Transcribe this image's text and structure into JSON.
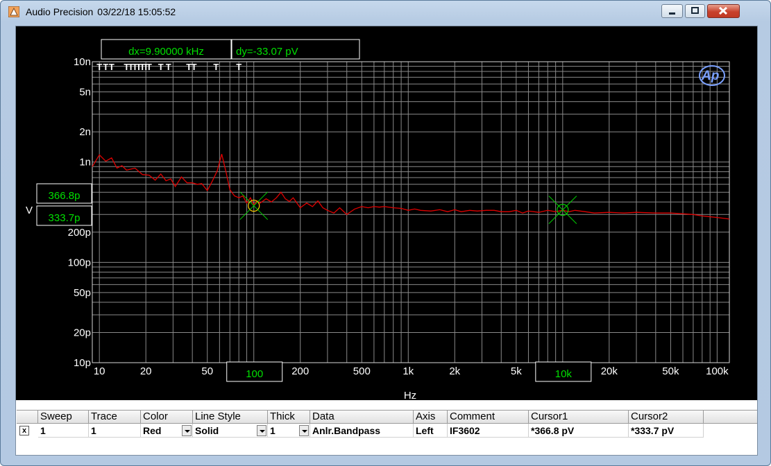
{
  "window": {
    "app_name": "Audio Precision",
    "timestamp": "03/22/18 15:05:52",
    "icon": "ap-app-icon",
    "buttons": [
      "minimize-icon",
      "maximize-icon",
      "close-icon"
    ]
  },
  "readouts": {
    "dx": "dx=9.90000 kHz",
    "dy": "dy=-33.07  pV",
    "cursor1_y": "366.8p",
    "cursor2_y": "333.7p",
    "cursor1_x": "100",
    "cursor2_x": "10k"
  },
  "colors": {
    "trace": "#e00000",
    "readout_text": "#00e000",
    "cursor1": "#ffd000",
    "cursor2": "#00d000",
    "grid": "#8a8a8a"
  },
  "chart_data": {
    "type": "line",
    "title": "",
    "xlabel": "Hz",
    "ylabel": "V",
    "x_scale": "log",
    "y_scale": "log",
    "xlim": [
      9,
      120000
    ],
    "ylim": [
      1e-11,
      1e-08
    ],
    "grid": true,
    "x_ticks": [
      {
        "v": 10,
        "label": "10"
      },
      {
        "v": 20,
        "label": "20"
      },
      {
        "v": 50,
        "label": "50"
      },
      {
        "v": 200,
        "label": "200"
      },
      {
        "v": 500,
        "label": "500"
      },
      {
        "v": 1000,
        "label": "1k"
      },
      {
        "v": 2000,
        "label": "2k"
      },
      {
        "v": 5000,
        "label": "5k"
      },
      {
        "v": 20000,
        "label": "20k"
      },
      {
        "v": 50000,
        "label": "50k"
      },
      {
        "v": 100000,
        "label": "100k"
      }
    ],
    "y_ticks": [
      {
        "v": 1e-08,
        "label": "10n"
      },
      {
        "v": 5e-09,
        "label": "5n"
      },
      {
        "v": 2e-09,
        "label": "2n"
      },
      {
        "v": 1e-09,
        "label": "1n"
      },
      {
        "v": 2e-10,
        "label": "200p"
      },
      {
        "v": 1e-10,
        "label": "100p"
      },
      {
        "v": 5e-11,
        "label": "50p"
      },
      {
        "v": 2e-11,
        "label": "20p"
      },
      {
        "v": 1e-11,
        "label": "10p"
      }
    ],
    "series": [
      {
        "color": "#e00000",
        "x": [
          9,
          10,
          11,
          12,
          13,
          14,
          15,
          17,
          19,
          21,
          23,
          25,
          27,
          29,
          31,
          34,
          37,
          40,
          43,
          46,
          50,
          54,
          58,
          62,
          66,
          70,
          75,
          80,
          85,
          90,
          95,
          100,
          105,
          110,
          120,
          130,
          140,
          150,
          160,
          170,
          180,
          190,
          200,
          220,
          240,
          260,
          280,
          300,
          330,
          360,
          400,
          450,
          500,
          550,
          600,
          650,
          700,
          800,
          900,
          1000,
          1100,
          1200,
          1400,
          1600,
          1800,
          2000,
          2200,
          2500,
          2800,
          3200,
          3600,
          4000,
          4500,
          5000,
          5500,
          6000,
          7000,
          8000,
          9000,
          10000,
          11000,
          12000,
          14000,
          16000,
          20000,
          25000,
          30000,
          40000,
          50000,
          60000,
          70000,
          80000,
          100000,
          120000
        ],
        "y": [
          9e-10,
          1.18e-09,
          1.02e-09,
          1.1e-09,
          8.7e-10,
          9.2e-10,
          8.3e-10,
          8.7e-10,
          7.5e-10,
          7.4e-10,
          6.6e-10,
          7.6e-10,
          6.5e-10,
          6.8e-10,
          5.7e-10,
          7.1e-10,
          6.2e-10,
          6.2e-10,
          6e-10,
          6.1e-10,
          5.2e-10,
          6.5e-10,
          8.2e-10,
          1.2e-09,
          8e-10,
          5.3e-10,
          4.6e-10,
          4.4e-10,
          4.6e-10,
          3.9e-10,
          4.4e-10,
          3.75e-10,
          4.1e-10,
          3.9e-10,
          4.3e-10,
          4e-10,
          4.4e-10,
          5e-10,
          4.3e-10,
          4.05e-10,
          4.4e-10,
          3.9e-10,
          3.5e-10,
          3.9e-10,
          3.6e-10,
          4.1e-10,
          3.5e-10,
          3.3e-10,
          3.1e-10,
          3.5e-10,
          3e-10,
          3.4e-10,
          3.6e-10,
          3.5e-10,
          3.6e-10,
          3.55e-10,
          3.6e-10,
          3.5e-10,
          3.45e-10,
          3.3e-10,
          3.4e-10,
          3.3e-10,
          3.25e-10,
          3.35e-10,
          3.2e-10,
          3.35e-10,
          3.2e-10,
          3.3e-10,
          3.25e-10,
          3.3e-10,
          3.3e-10,
          3.2e-10,
          3.2e-10,
          3.3e-10,
          3.1e-10,
          3.25e-10,
          3.15e-10,
          3.3e-10,
          3.2e-10,
          3.3e-10,
          3.2e-10,
          3.3e-10,
          3.2e-10,
          3.1e-10,
          3.15e-10,
          3.1e-10,
          3.15e-10,
          3.1e-10,
          3.1e-10,
          3.05e-10,
          3e-10,
          2.9e-10,
          2.8e-10,
          2.7e-10
        ]
      }
    ],
    "markers": [
      {
        "x": 100,
        "y": 3.668e-10,
        "name": "cursor1"
      },
      {
        "x": 10000,
        "y": 3.337e-10,
        "name": "cursor2"
      }
    ],
    "annotations": {
      "tick_marks_label": "T",
      "tick_mark_positions": [
        10,
        11,
        12,
        15,
        16,
        17,
        18,
        19,
        20,
        21,
        25,
        28,
        38,
        41,
        57,
        80
      ]
    }
  },
  "table": {
    "columns": [
      "Sweep",
      "Trace",
      "Color",
      "Line Style",
      "Thick",
      "Data",
      "Axis",
      "Comment",
      "Cursor1",
      "Cursor2"
    ],
    "rows": [
      {
        "enabled": "x",
        "sweep": "1",
        "trace": "1",
        "color": "Red",
        "line_style": "Solid",
        "thick": "1",
        "data": "Anlr.Bandpass",
        "axis": "Left",
        "comment": "IF3602",
        "cursor1": "*366.8  pV",
        "cursor2": "*333.7  pV"
      }
    ]
  }
}
